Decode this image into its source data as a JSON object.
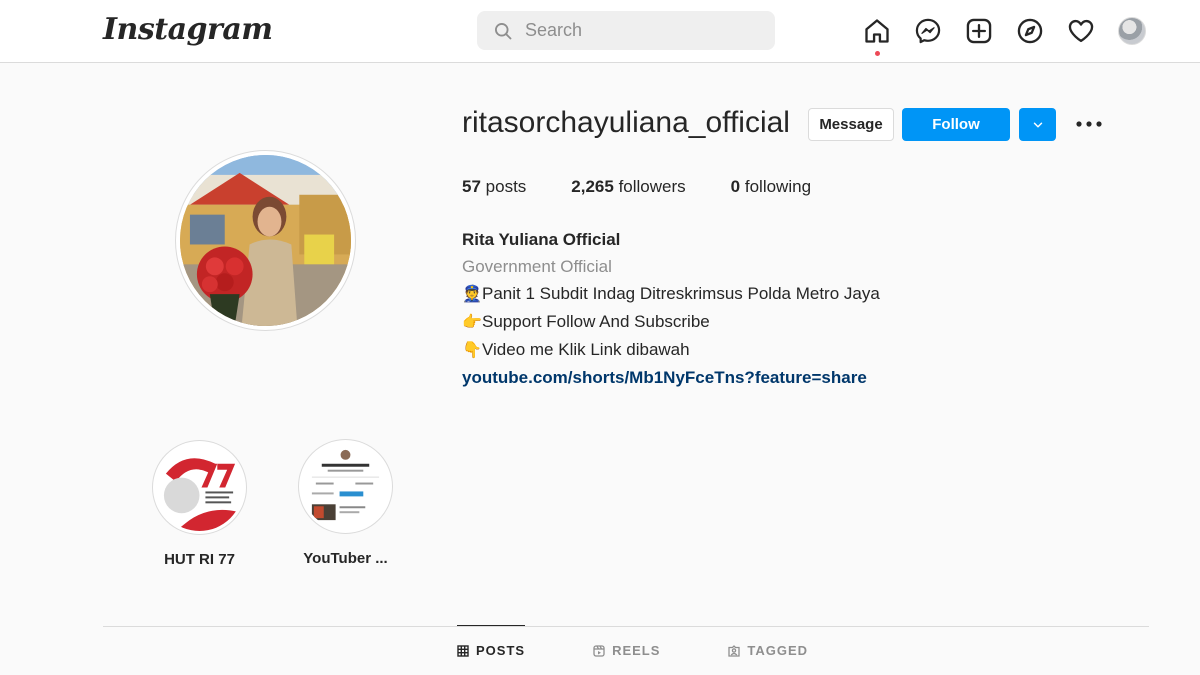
{
  "header": {
    "logo": "Instagram",
    "search_placeholder": "Search",
    "icons": [
      "home-icon",
      "messenger-icon",
      "new-post-icon",
      "explore-icon",
      "activity-heart-icon",
      "profile-avatar"
    ]
  },
  "profile": {
    "username": "ritasorchayuliana_official",
    "message_label": "Message",
    "follow_label": "Follow",
    "stats": {
      "posts_count": "57",
      "posts_label": "posts",
      "followers_count": "2,265",
      "followers_label": "followers",
      "following_count": "0",
      "following_label": "following"
    },
    "bio": {
      "name": "Rita Yuliana Official",
      "category": "Government Official",
      "lines": [
        {
          "emoji": "👮",
          "text": "Panit 1 Subdit Indag Ditreskrimsus Polda Metro Jaya"
        },
        {
          "emoji": "👉",
          "text": "Support Follow And Subscribe"
        },
        {
          "emoji": "👇",
          "text": "Video me Klik Link dibawah"
        }
      ],
      "link": "youtube.com/shorts/Mb1NyFceTns?feature=share"
    }
  },
  "highlights": [
    {
      "title": "HUT RI 77"
    },
    {
      "title": "YouTuber ..."
    }
  ],
  "tabs": [
    {
      "label": "POSTS",
      "active": true
    },
    {
      "label": "REELS",
      "active": false
    },
    {
      "label": "TAGGED",
      "active": false
    }
  ],
  "colors": {
    "accent": "#0095f6",
    "link": "#00376b",
    "notification_dot": "#ed4956"
  }
}
